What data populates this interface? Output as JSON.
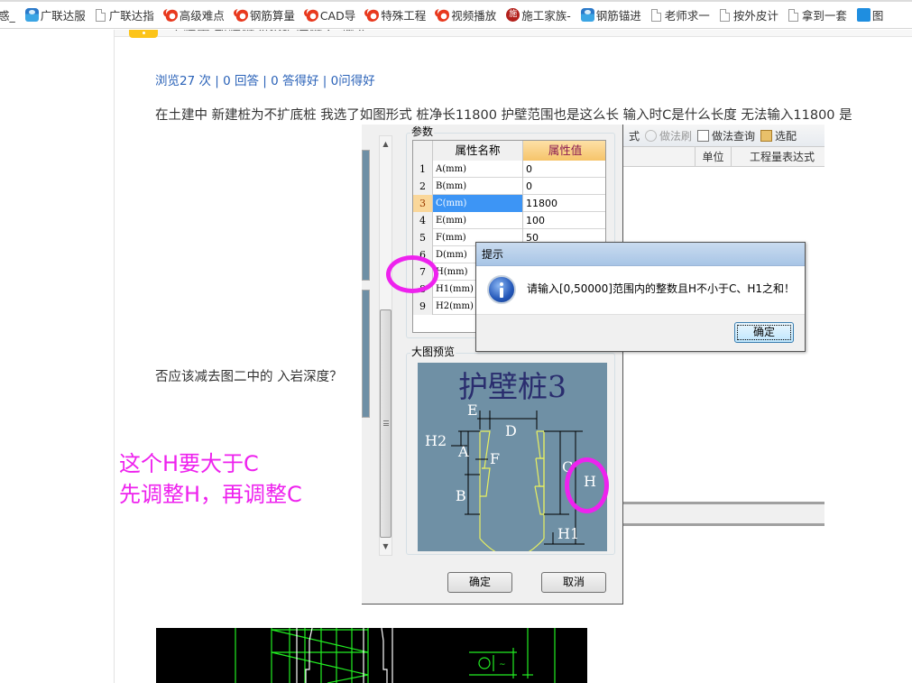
{
  "bookmarks": [
    {
      "icon": "text-fragment",
      "label": "惑_"
    },
    {
      "icon": "service-icon",
      "label": "广联达服"
    },
    {
      "icon": "page-icon",
      "label": "广联达指"
    },
    {
      "icon": "swirl-icon",
      "label": "高级难点"
    },
    {
      "icon": "swirl-icon",
      "label": "钢筋算量"
    },
    {
      "icon": "swirl-icon",
      "label": "CAD导"
    },
    {
      "icon": "swirl-icon",
      "label": "特殊工程"
    },
    {
      "icon": "swirl-icon",
      "label": "视频播放"
    },
    {
      "icon": "shigong-icon",
      "label": "施工家族-",
      "icon_text": "施"
    },
    {
      "icon": "service-icon",
      "label": "钢筋锚进"
    },
    {
      "icon": "page-icon",
      "label": "老师求一"
    },
    {
      "icon": "page-icon",
      "label": "按外皮计"
    },
    {
      "icon": "page-icon",
      "label": "拿到一套"
    },
    {
      "icon": "blue-square-icon",
      "label": "图"
    }
  ],
  "question": {
    "title_partial": "土建中 新建桩为不扩底桩 C 输入",
    "stats": "浏览27 次 | 0 回答 | 0 答得好 | 0问得好",
    "body_line1": "在土建中 新建桩为不扩底桩 我选了如图形式 桩净长11800 护壁范围也是这么长 输入时C是什么长度 无法输入11800 是",
    "body_line2": "否应该减去图二中的 入岩深度？"
  },
  "annotation": {
    "line1": "这个H要大于C",
    "line2": "先调整H，再调整C",
    "color": "#ee22ee"
  },
  "background_window": {
    "toolbar": [
      {
        "label": "式",
        "enabled": true
      },
      {
        "label": "做法刷",
        "enabled": false,
        "icon": "brush-icon"
      },
      {
        "label": "做法查询",
        "enabled": true,
        "icon": "query-icon"
      },
      {
        "label": "选配",
        "enabled": true,
        "icon": "clipboard-icon"
      }
    ],
    "columns": [
      "",
      "单位",
      "工程量表达式"
    ]
  },
  "param_dialog": {
    "params_group_label": "参数",
    "preview_group_label": "大图预览",
    "table": {
      "headers": [
        "",
        "属性名称",
        "属性值"
      ],
      "rows": [
        {
          "num": "1",
          "name": "A(mm)",
          "value": "0"
        },
        {
          "num": "2",
          "name": "B(mm)",
          "value": "0"
        },
        {
          "num": "3",
          "name": "C(mm)",
          "value": "11800",
          "selected": true
        },
        {
          "num": "4",
          "name": "E(mm)",
          "value": "100"
        },
        {
          "num": "5",
          "name": "F(mm)",
          "value": "50"
        },
        {
          "num": "6",
          "name": "D(mm)",
          "value": ""
        },
        {
          "num": "7",
          "name": "H(mm)",
          "value": ""
        },
        {
          "num": "8",
          "name": "H1(mm)",
          "value": ""
        },
        {
          "num": "9",
          "name": "H2(mm)",
          "value": ""
        }
      ]
    },
    "preview": {
      "title": "护壁桩3",
      "labels": [
        "E",
        "D",
        "H2",
        "A",
        "F",
        "B",
        "C",
        "H",
        "H1"
      ]
    },
    "ok_label": "确定",
    "cancel_label": "取消"
  },
  "alert": {
    "title": "提示",
    "message": "请输入[0,50000]范围内的整数且H不小于C、H1之和！",
    "ok_label": "确定"
  }
}
